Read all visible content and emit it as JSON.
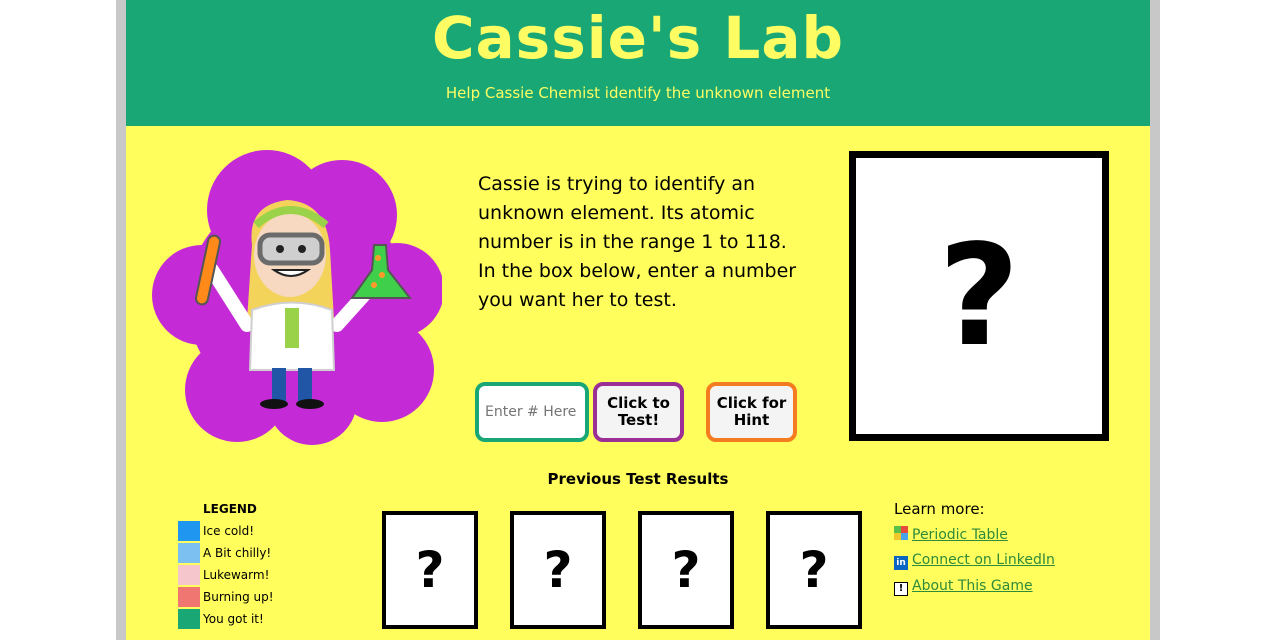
{
  "header": {
    "title": "Cassie's Lab",
    "subtitle": "Help Cassie Chemist identify the unknown element"
  },
  "intro": {
    "text": "Cassie is trying to identify an unknown element. Its atomic number is in the range 1 to 118. In the box below, enter a number you want her to test."
  },
  "controls": {
    "input_placeholder": "Enter # Here",
    "input_value": "",
    "test_label": "Click to Test!",
    "hint_label": "Click for Hint"
  },
  "mystery_box": {
    "symbol": "?"
  },
  "previous": {
    "title": "Previous Test Results",
    "results": [
      "?",
      "?",
      "?",
      "?"
    ]
  },
  "legend": {
    "title": "LEGEND",
    "items": [
      {
        "label": "Ice cold!",
        "color": "#1f97f0"
      },
      {
        "label": "A Bit chilly!",
        "color": "#7cc0f2"
      },
      {
        "label": "Lukewarm!",
        "color": "#f5c6cc"
      },
      {
        "label": "Burning up!",
        "color": "#f07672"
      },
      {
        "label": "You got it!",
        "color": "#19a776"
      }
    ]
  },
  "learn_more": {
    "title": "Learn more:",
    "links": [
      {
        "label": "Periodic Table",
        "icon": "periodic-table-icon"
      },
      {
        "label": "Connect on LinkedIn",
        "icon": "linkedin-icon"
      },
      {
        "label": "About This Game",
        "icon": "info-icon"
      }
    ]
  },
  "colors": {
    "page_bg": "#fffe5d",
    "header_bg": "#19a776",
    "title_text": "#fdfd63",
    "blob": "#c42bd6"
  }
}
